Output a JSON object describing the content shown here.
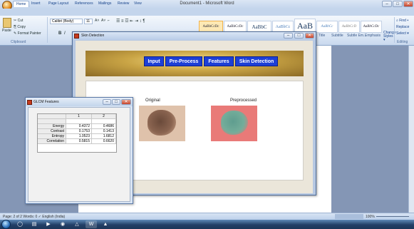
{
  "word": {
    "title": "Document1 - Microsoft Word",
    "qat": "↶ ↷ ▾",
    "tabs": [
      "Home",
      "Insert",
      "Page Layout",
      "References",
      "Mailings",
      "Review",
      "View"
    ],
    "clipboard": {
      "paste": "Paste",
      "cut": "✂ Cut",
      "copy": "⎘ Copy",
      "format_painter": "✎ Format Painter",
      "group": "Clipboard"
    },
    "font": {
      "name": "Calibri (Body)",
      "size": "11",
      "grow": "A˄",
      "shrink": "A˅",
      "clear": "⌐",
      "bold": "B",
      "italic": "I"
    },
    "paragraph_symbols": "☰ ≡ ☲ ⇤ ⇥ ↕ ¶",
    "styles": [
      "AaBbCcDc",
      "AaBbCcDc",
      "AaBbC",
      "AaBbCc",
      "AaB",
      "AaBbCc",
      "AaBbCcD",
      "AaBbCcDc"
    ],
    "styles_labels": {
      "title": "Title",
      "subtitle": "Subtitle",
      "subtle_emphasis": "Subtle Em...",
      "emphasis": "Emphasis"
    },
    "change_styles": "Change Styles ▾",
    "editing": {
      "find": "⌕ Find ▾",
      "replace": "Replace",
      "select": "Select ▾",
      "group": "Editing"
    },
    "status": "Page: 2 of 2    Words: 0    ✓    English (India)",
    "zoom": "100%"
  },
  "skin_window": {
    "title": "Skin Detection",
    "nav": [
      "Input",
      "Pre-Process",
      "Features",
      "Skin Detection"
    ],
    "label_original": "Original",
    "label_preprocessed": "Preprocessed"
  },
  "glcm_window": {
    "title": "GLCM Features",
    "columns": [
      "1",
      "2"
    ],
    "rows": [
      {
        "name": "Energy",
        "v1": "0.4372",
        "v2": "0.4686"
      },
      {
        "name": "Contrast",
        "v1": "0.1753",
        "v2": "0.1413"
      },
      {
        "name": "Entropy",
        "v1": "1.0523",
        "v2": "1.6812"
      },
      {
        "name": "Correlation",
        "v1": "0.5815",
        "v2": "0.6620"
      }
    ]
  },
  "colors": {
    "nav_button": "#1d3fd6",
    "banner_gold": "#c9a445",
    "ribbon_blue": "#c4d5ec"
  }
}
